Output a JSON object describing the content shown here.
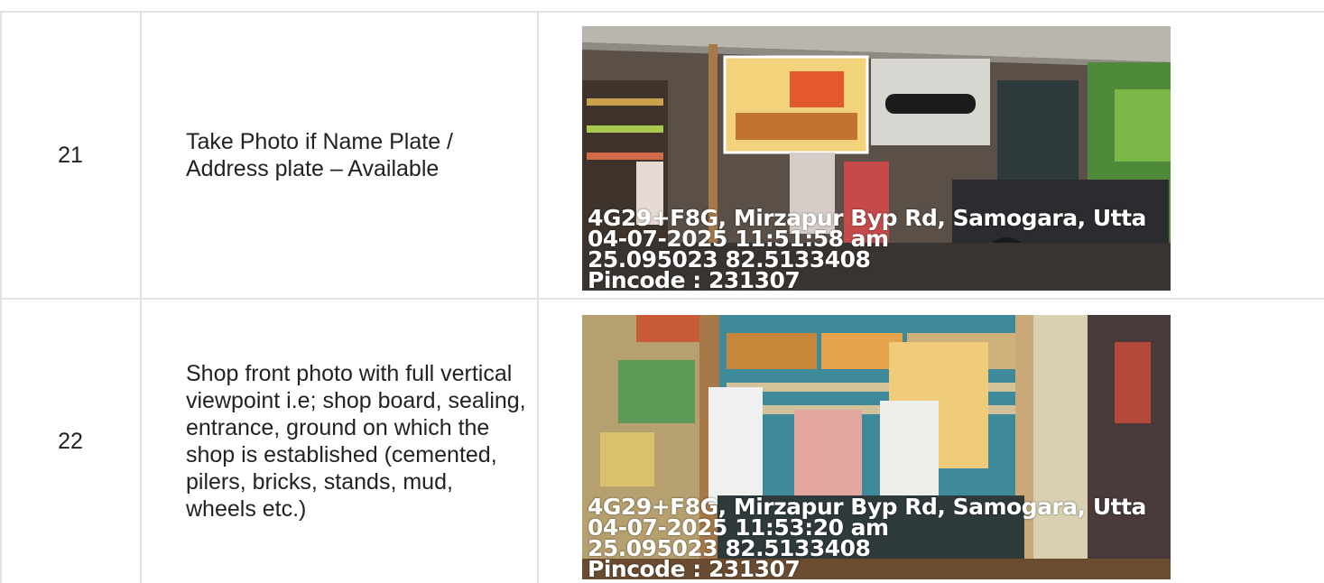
{
  "rows": [
    {
      "number": "21",
      "description": "Take Photo if Name Plate / Address plate – Available",
      "photo": {
        "address": "4G29+F8G, Mirzapur Byp Rd, Samogara, Utta",
        "datetime": "04-07-2025 11:51:58 am",
        "coords": "25.095023 82.5133408",
        "pincode": "Pincode : 231307"
      }
    },
    {
      "number": "22",
      "description": "Shop front photo with full vertical viewpoint i.e; shop board, sealing, entrance, ground on which the shop is established (cemented, pilers, bricks, stands, mud, wheels etc.)",
      "photo": {
        "address": "4G29+F8G, Mirzapur Byp Rd, Samogara, Utta",
        "datetime": "04-07-2025 11:53:20 am",
        "coords": "25.095023 82.5133408",
        "pincode": "Pincode : 231307"
      }
    }
  ]
}
